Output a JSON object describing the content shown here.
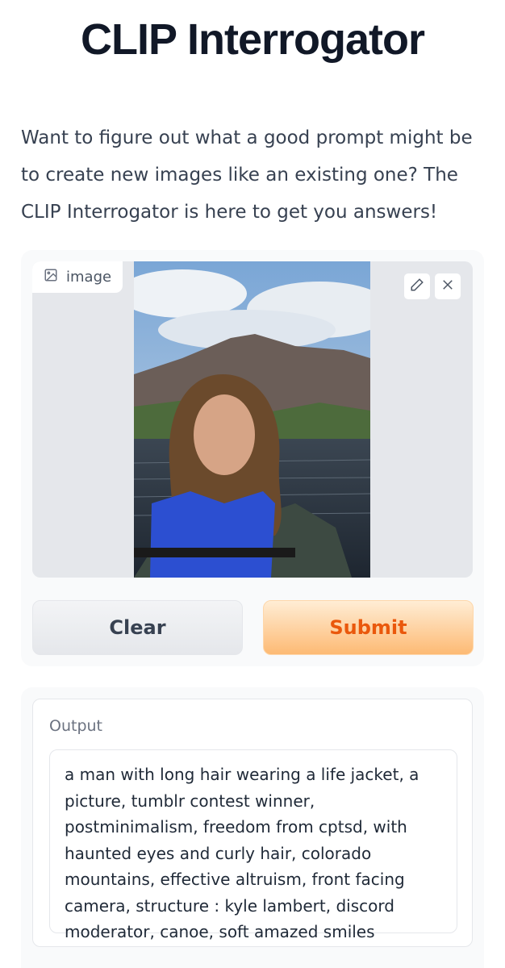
{
  "app": {
    "title": "CLIP Interrogator",
    "description": "Want to figure out what a good prompt might be to create new images like an existing one? The CLIP Interrogator is here to get you answers!"
  },
  "input": {
    "image_label": "image",
    "image_icon": "image-icon",
    "edit_icon": "pencil-icon",
    "close_icon": "close-icon",
    "clear_label": "Clear",
    "submit_label": "Submit"
  },
  "output": {
    "label": "Output",
    "text": "a man with long hair wearing a life jacket, a picture, tumblr contest winner, postminimalism, freedom from cptsd, with haunted eyes and curly hair, colorado mountains, effective altruism, front facing camera, structure : kyle lambert, discord moderator, canoe, soft amazed smiles"
  },
  "colors": {
    "accent": "#ea580c",
    "submit_bg": "#fdba74",
    "panel_bg": "#f9fafb"
  }
}
